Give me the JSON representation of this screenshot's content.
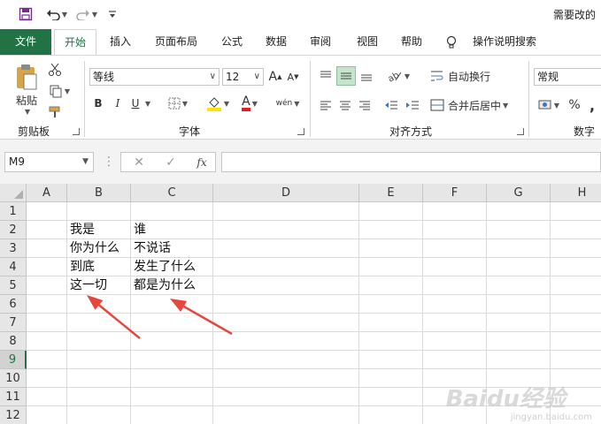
{
  "window": {
    "title": "需要改的"
  },
  "quick_access": {
    "save_icon": "save-icon",
    "undo_icon": "undo-icon",
    "redo_icon": "redo-icon",
    "customize_icon": "customize-qat-icon"
  },
  "tabs": [
    {
      "label": "文件"
    },
    {
      "label": "开始"
    },
    {
      "label": "插入"
    },
    {
      "label": "页面布局"
    },
    {
      "label": "公式"
    },
    {
      "label": "数据"
    },
    {
      "label": "审阅"
    },
    {
      "label": "视图"
    },
    {
      "label": "帮助"
    },
    {
      "label": "操作说明搜索"
    }
  ],
  "ribbon": {
    "clipboard": {
      "label": "剪贴板",
      "paste_label": "粘贴"
    },
    "font": {
      "label": "字体",
      "font_name": "等线",
      "font_size": "12",
      "bold": "B",
      "italic": "I",
      "underline": "U",
      "grow_font": "A",
      "shrink_font": "A",
      "font_color": "A",
      "phonetic": "wén"
    },
    "alignment": {
      "label": "对齐方式",
      "wrap_text": "自动换行",
      "merge_center": "合并后居中"
    },
    "number": {
      "label": "数字",
      "format": "常规",
      "percent": "%",
      "comma": ","
    }
  },
  "formula_bar": {
    "name_box": "M9",
    "fx": "fx",
    "formula": ""
  },
  "columns": [
    "A",
    "B",
    "C",
    "D",
    "E",
    "F",
    "G",
    "H"
  ],
  "rows": [
    "1",
    "2",
    "3",
    "4",
    "5",
    "6",
    "7",
    "8",
    "9",
    "10",
    "11",
    "12"
  ],
  "selected_row": "9",
  "cells": {
    "B2": "我是",
    "C2": "谁",
    "B3": "你为什么",
    "C3": "不说话",
    "B4": "到底",
    "C4": "发生了什么",
    "B5": "这一切",
    "C5": "都是为什么"
  },
  "annotation": {
    "arrow_color": "#e8453c"
  },
  "watermark": {
    "text": "Baidu经验",
    "sub": "jingyan.baidu.com"
  },
  "colors": {
    "accent": "#217346"
  }
}
